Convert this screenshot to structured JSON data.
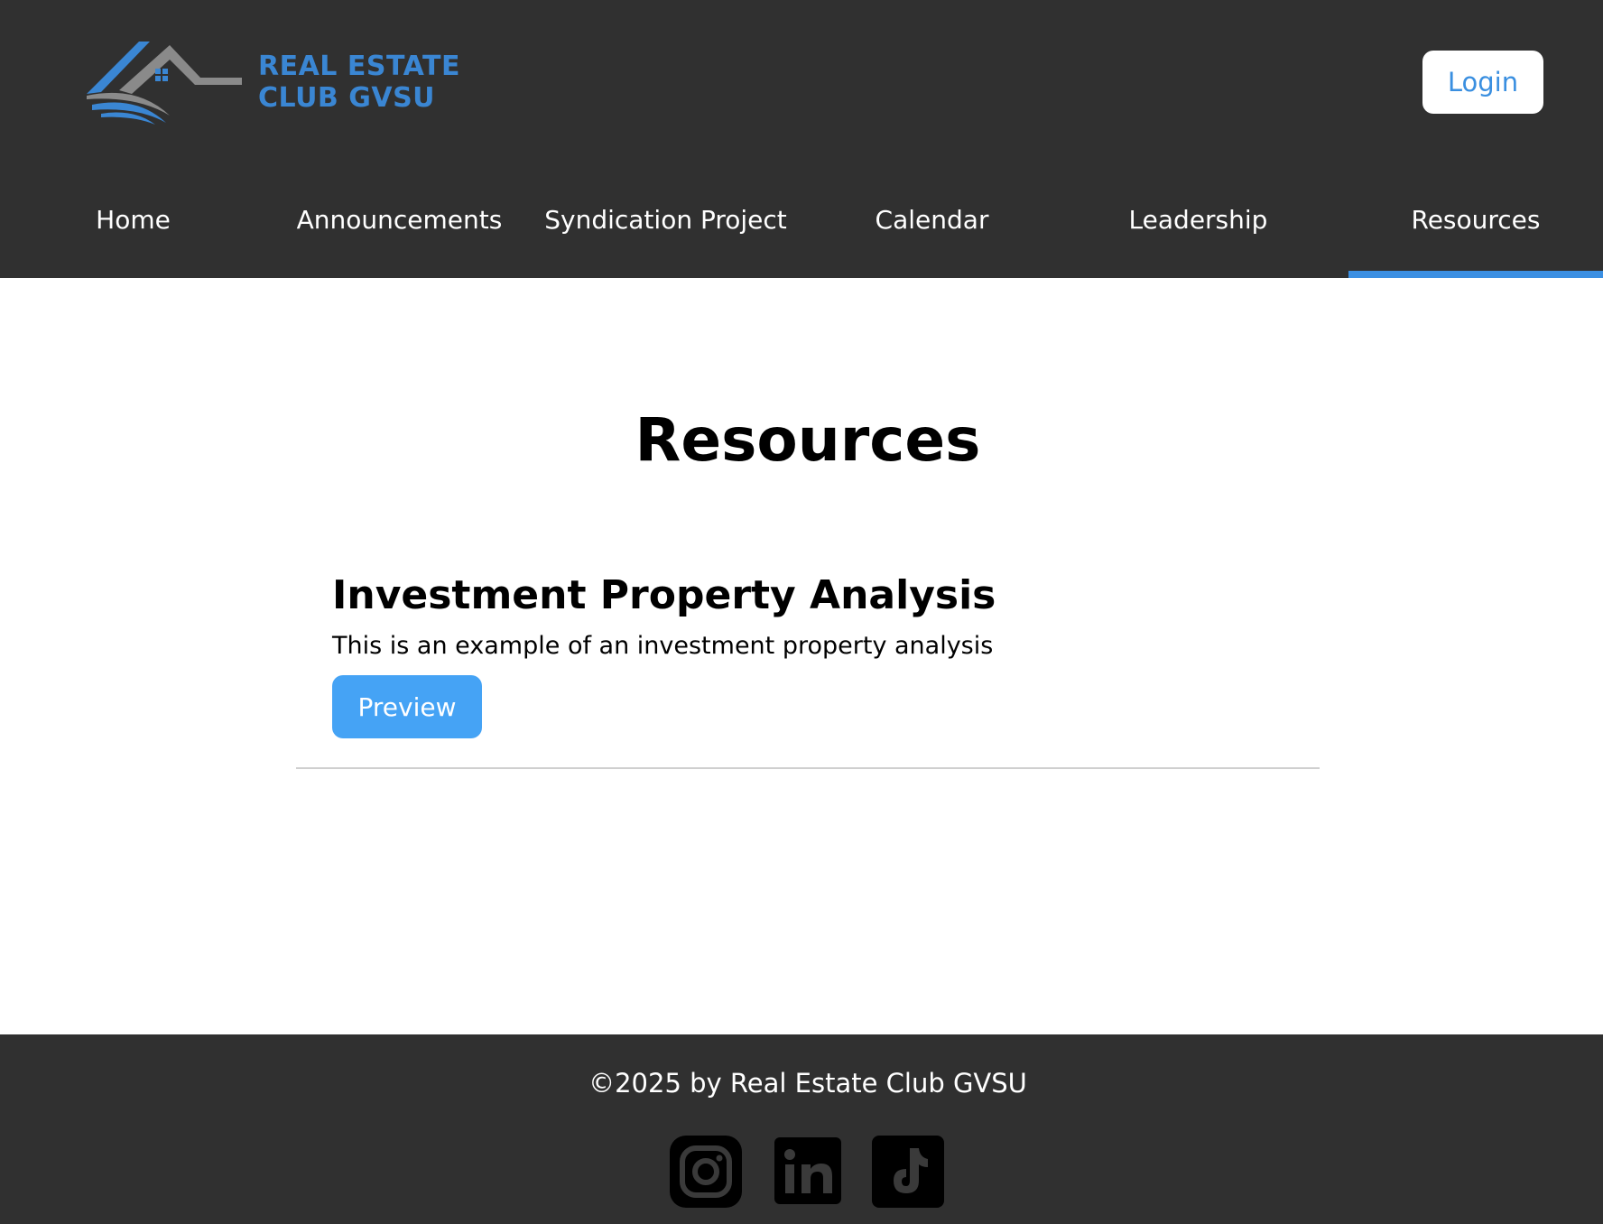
{
  "header": {
    "logo": {
      "line1": "REAL ESTATE",
      "line2": "CLUB GVSU"
    },
    "login_label": "Login",
    "nav": [
      {
        "label": "Home",
        "active": false
      },
      {
        "label": "Announcements",
        "active": false
      },
      {
        "label": "Syndication Project",
        "active": false
      },
      {
        "label": "Calendar",
        "active": false
      },
      {
        "label": "Leadership",
        "active": false
      },
      {
        "label": "Resources",
        "active": true
      }
    ]
  },
  "main": {
    "title": "Resources",
    "resources": [
      {
        "title": "Investment Property Analysis",
        "description": "This is an example of an investment property analysis",
        "button_label": "Preview"
      }
    ]
  },
  "footer": {
    "copyright": "©2025 by Real Estate Club GVSU",
    "social": [
      {
        "icon": "instagram-icon"
      },
      {
        "icon": "linkedin-icon"
      },
      {
        "icon": "tiktok-icon"
      }
    ]
  },
  "colors": {
    "header_bg": "#303030",
    "accent_blue": "#3b8fe2",
    "preview_button": "#45a3f5",
    "logo_blue": "#3a86d3",
    "logo_gray": "#8a8a8a"
  }
}
